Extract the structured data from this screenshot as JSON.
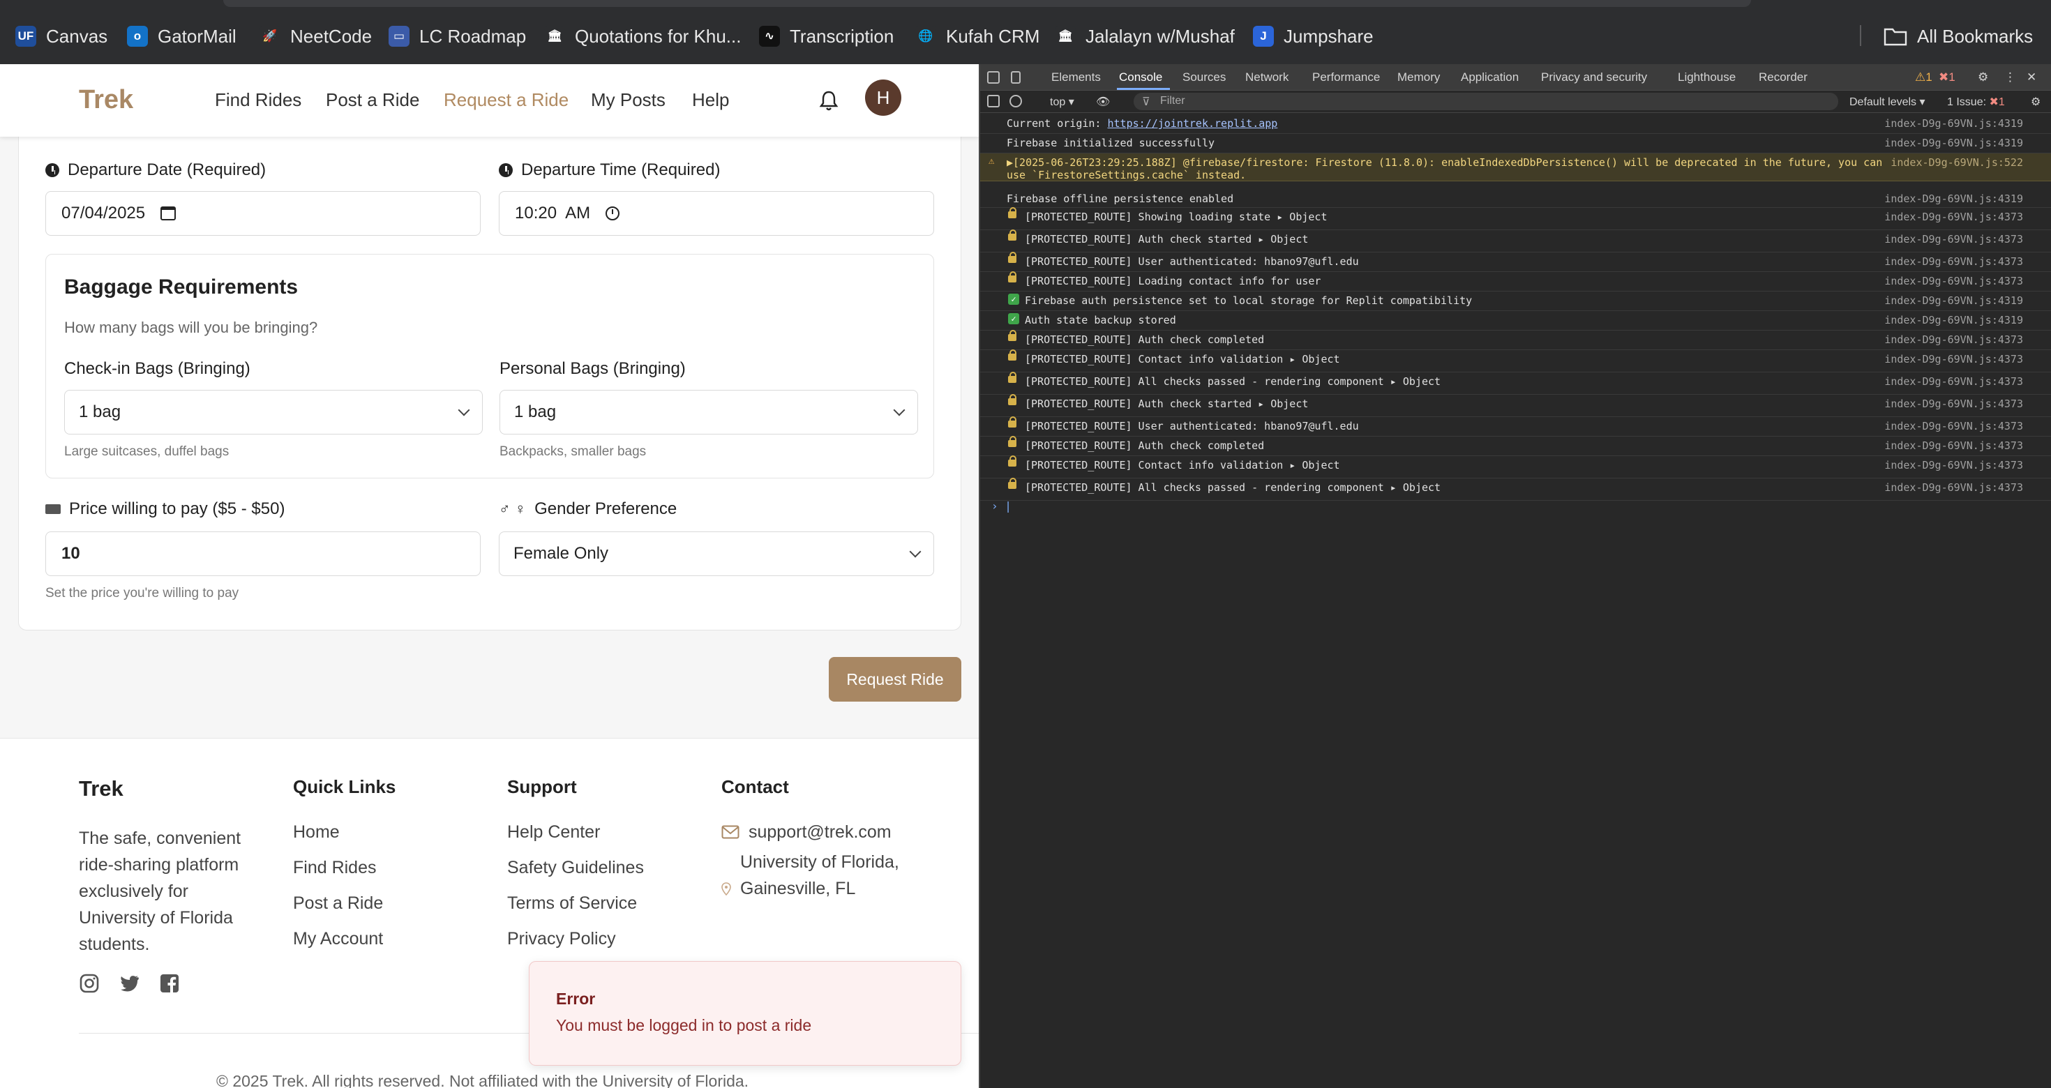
{
  "bookmarks": [
    {
      "label": "Canvas",
      "icon": "uf-icon",
      "color": "#1f4e9b",
      "glyph": "UF"
    },
    {
      "label": "GatorMail",
      "icon": "outlook-icon",
      "color": "#1372c7",
      "glyph": "o"
    },
    {
      "label": "NeetCode",
      "icon": "rocket-icon",
      "color": "#2d2e30",
      "glyph": "🚀"
    },
    {
      "label": "LC Roadmap",
      "icon": "lc-icon",
      "color": "#3b5ba8",
      "glyph": "▭"
    },
    {
      "label": "Quotations for Khu...",
      "icon": "museum-icon",
      "color": "#2d2e30",
      "glyph": "🏛"
    },
    {
      "label": "Transcription",
      "icon": "wave-icon",
      "color": "#111111",
      "glyph": "∿"
    },
    {
      "label": "Kufah CRM",
      "icon": "globe-icon",
      "color": "#2d2e30",
      "glyph": "🌐"
    },
    {
      "label": "Jalalayn w/Mushaf",
      "icon": "museum-icon",
      "color": "#2d2e30",
      "glyph": "🏛"
    },
    {
      "label": "Jumpshare",
      "icon": "jumpshare-icon",
      "color": "#2b65d9",
      "glyph": "J"
    }
  ],
  "all_bookmarks": "All Bookmarks",
  "nav": {
    "brand": "Trek",
    "links": [
      "Find Rides",
      "Post a Ride",
      "Request a Ride",
      "My Posts",
      "Help"
    ],
    "active": "Request a Ride",
    "avatar": "H"
  },
  "form": {
    "date_label": "Departure Date (Required)",
    "date_value": "07/04/2025",
    "time_label": "Departure Time (Required)",
    "time_value": "10:20  AM",
    "baggage_title": "Baggage Requirements",
    "baggage_sub": "How many bags will you be bringing?",
    "checkin_label": "Check-in Bags (Bringing)",
    "checkin_value": "1 bag",
    "checkin_help": "Large suitcases, duffel bags",
    "personal_label": "Personal Bags (Bringing)",
    "personal_value": "1 bag",
    "personal_help": "Backpacks, smaller bags",
    "price_label": "Price willing to pay ($5 - $50)",
    "price_value": "10",
    "price_help": "Set the price you're willing to pay",
    "gender_label": "Gender Preference",
    "gender_value": "Female Only",
    "submit": "Request Ride"
  },
  "footer": {
    "brand": "Trek",
    "tagline": "The safe, convenient ride-sharing platform exclusively for University of Florida students.",
    "quick_links_title": "Quick Links",
    "quick_links": [
      "Home",
      "Find Rides",
      "Post a Ride",
      "My Account"
    ],
    "support_title": "Support",
    "support_links": [
      "Help Center",
      "Safety Guidelines",
      "Terms of Service",
      "Privacy Policy"
    ],
    "contact_title": "Contact",
    "email": "support@trek.com",
    "address": "University of Florida, Gainesville, FL",
    "copyright": "© 2025 Trek. All rights reserved. Not affiliated with the University of Florida."
  },
  "toast": {
    "title": "Error",
    "message": "You must be logged in to post a ride"
  },
  "devtools": {
    "tabs": [
      "Elements",
      "Console",
      "Sources",
      "Network",
      "Performance",
      "Memory",
      "Application",
      "Privacy and security",
      "Lighthouse",
      "Recorder"
    ],
    "active_tab": "Console",
    "warn_count": "1",
    "error_count": "1",
    "context": "top",
    "filter_placeholder": "Filter",
    "levels": "Default levels",
    "issues": "1 Issue:",
    "issues_count": "1",
    "logs": [
      {
        "icon": "none",
        "text": "Current origin: ",
        "link": "https://jointrek.replit.app",
        "src": "index-D9g-69VN.js:4319"
      },
      {
        "icon": "none",
        "text": "Firebase initialized successfully",
        "src": "index-D9g-69VN.js:4319"
      },
      {
        "icon": "warn",
        "text": "▶[2025-06-26T23:29:25.188Z]  @firebase/firestore: Firestore (11.8.0): enableIndexedDbPersistence() will be deprecated in the future, you can",
        "text2": "use `FirestoreSettings.cache` instead.",
        "src": "index-D9g-69VN.js:522"
      },
      {
        "icon": "none",
        "text": "Firebase offline persistence enabled",
        "src": "index-D9g-69VN.js:4319"
      },
      {
        "icon": "lock",
        "text": "[PROTECTED_ROUTE] Showing loading state",
        "obj": "▸ Object",
        "src": "index-D9g-69VN.js:4373"
      },
      {
        "icon": "lock",
        "text": "[PROTECTED_ROUTE] Auth check started",
        "obj": "▸ Object",
        "src": "index-D9g-69VN.js:4373"
      },
      {
        "icon": "lock",
        "text": "[PROTECTED_ROUTE] User authenticated: hbano97@ufl.edu",
        "src": "index-D9g-69VN.js:4373"
      },
      {
        "icon": "lock",
        "text": "[PROTECTED_ROUTE] Loading contact info for user",
        "src": "index-D9g-69VN.js:4373"
      },
      {
        "icon": "check",
        "text": "Firebase auth persistence set to local storage for Replit compatibility",
        "src": "index-D9g-69VN.js:4319"
      },
      {
        "icon": "check",
        "text": "Auth state backup stored",
        "src": "index-D9g-69VN.js:4319"
      },
      {
        "icon": "lock",
        "text": "[PROTECTED_ROUTE] Auth check completed",
        "src": "index-D9g-69VN.js:4373"
      },
      {
        "icon": "lock",
        "text": "[PROTECTED_ROUTE] Contact info validation",
        "obj": "▸ Object",
        "src": "index-D9g-69VN.js:4373"
      },
      {
        "icon": "lock",
        "text": "[PROTECTED_ROUTE] All checks passed - rendering component",
        "obj": "▸ Object",
        "src": "index-D9g-69VN.js:4373"
      },
      {
        "icon": "lock",
        "text": "[PROTECTED_ROUTE] Auth check started",
        "obj": "▸ Object",
        "src": "index-D9g-69VN.js:4373"
      },
      {
        "icon": "lock",
        "text": "[PROTECTED_ROUTE] User authenticated: hbano97@ufl.edu",
        "src": "index-D9g-69VN.js:4373"
      },
      {
        "icon": "lock",
        "text": "[PROTECTED_ROUTE] Auth check completed",
        "src": "index-D9g-69VN.js:4373"
      },
      {
        "icon": "lock",
        "text": "[PROTECTED_ROUTE] Contact info validation",
        "obj": "▸ Object",
        "src": "index-D9g-69VN.js:4373"
      },
      {
        "icon": "lock",
        "text": "[PROTECTED_ROUTE] All checks passed - rendering component",
        "obj": "▸ Object",
        "src": "index-D9g-69VN.js:4373"
      }
    ],
    "prompt": "›"
  }
}
